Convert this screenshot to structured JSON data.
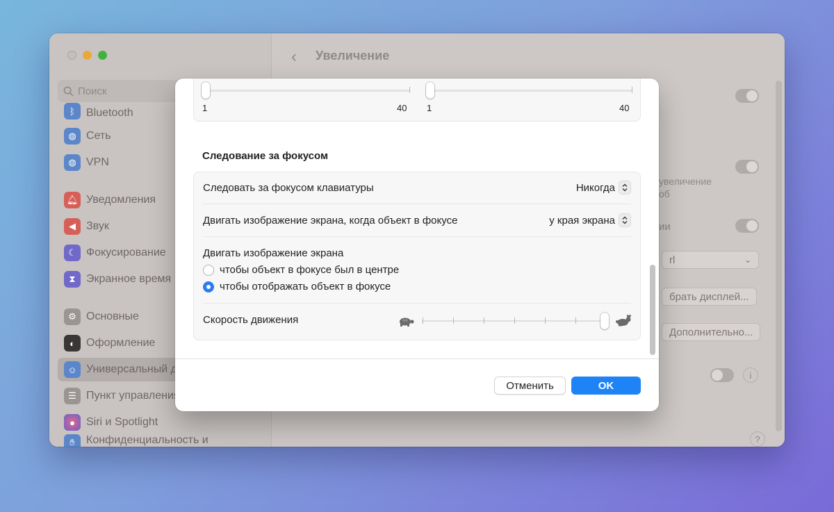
{
  "window": {
    "title": "Увеличение"
  },
  "sidebar": {
    "search_placeholder": "Поиск",
    "items": [
      {
        "label": "Bluetooth",
        "icon": "bluetooth-icon",
        "color": "#5b86c9"
      },
      {
        "label": "Сеть",
        "icon": "globe-icon",
        "color": "#5b86c9"
      },
      {
        "label": "VPN",
        "icon": "globe-icon",
        "color": "#5b86c9"
      },
      {
        "label": "Уведомления",
        "icon": "bell-icon",
        "color": "#d66059"
      },
      {
        "label": "Звук",
        "icon": "speaker-icon",
        "color": "#d66059"
      },
      {
        "label": "Фокусирование",
        "icon": "moon-icon",
        "color": "#7069c9"
      },
      {
        "label": "Экранное время",
        "icon": "hourglass-icon",
        "color": "#7069c9"
      },
      {
        "label": "Основные",
        "icon": "gear-icon",
        "color": "#9a9492"
      },
      {
        "label": "Оформление",
        "icon": "appearance-icon",
        "color": "#3b3636"
      },
      {
        "label": "Универсальный доступ",
        "icon": "accessibility-icon",
        "color": "#5b86c9"
      },
      {
        "label": "Пункт управления",
        "icon": "control-center-icon",
        "color": "#9a9492"
      },
      {
        "label": "Siri и Spotlight",
        "icon": "siri-icon",
        "color": "#6b5fc9"
      },
      {
        "label": "Конфиденциальность и",
        "icon": "hand-icon",
        "color": "#5b86c9"
      }
    ]
  },
  "background": {
    "text_a": "увеличение",
    "text_b": "об",
    "text_c": "ии",
    "select_value": "rl",
    "button_display": "брать дисплей...",
    "button_advanced": "Дополнительно...",
    "help": "?",
    "info": "i"
  },
  "sheet": {
    "slider1": {
      "min_label": "1",
      "max_label": "40",
      "value": 1
    },
    "slider2": {
      "min_label": "1",
      "max_label": "40",
      "value": 1
    },
    "section_title": "Следование за фокусом",
    "keyboard_focus": {
      "label": "Следовать за фокусом клавиатуры",
      "value": "Никогда"
    },
    "move_on_focus": {
      "label": "Двигать изображение экрана, когда объект в фокусе",
      "value": "у края экрана"
    },
    "move_image": {
      "label": "Двигать изображение экрана",
      "options": [
        {
          "label": "чтобы объект в фокусе был в центре",
          "selected": false
        },
        {
          "label": "чтобы отображать объект в фокусе",
          "selected": true
        }
      ]
    },
    "speed": {
      "label": "Скорость движения",
      "value": 1.0
    },
    "cancel_label": "Отменить",
    "ok_label": "OK"
  },
  "colors": {
    "accent": "#1e83f5"
  }
}
